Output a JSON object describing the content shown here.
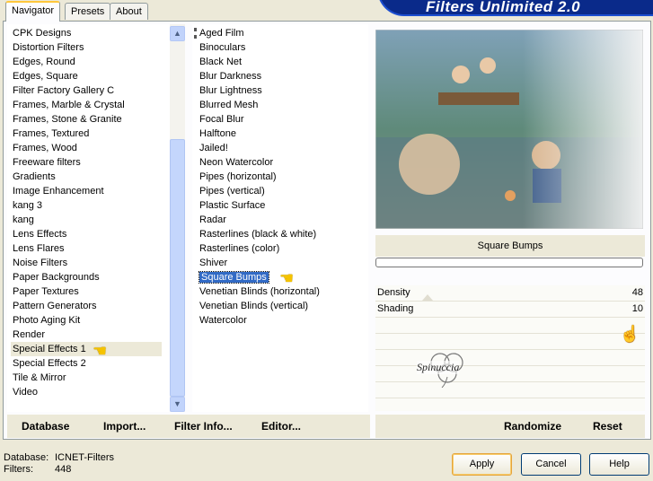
{
  "tabs": [
    {
      "label": "Navigator",
      "active": true
    },
    {
      "label": "Presets",
      "active": false
    },
    {
      "label": "About",
      "active": false
    }
  ],
  "banner_title": "Filters Unlimited 2.0",
  "categories": {
    "items": [
      "CPK Designs",
      "Distortion Filters",
      "Edges, Round",
      "Edges, Square",
      "Filter Factory Gallery C",
      "Frames, Marble & Crystal",
      "Frames, Stone & Granite",
      "Frames, Textured",
      "Frames, Wood",
      "Freeware filters",
      "Gradients",
      "Image Enhancement",
      "kang 3",
      "kang",
      "Lens Effects",
      "Lens Flares",
      "Noise Filters",
      "Paper Backgrounds",
      "Paper Textures",
      "Pattern Generators",
      "Photo Aging Kit",
      "Render",
      "Special Effects 1",
      "Special Effects 2",
      "Tile & Mirror",
      "Video"
    ],
    "selected": "Special Effects 1"
  },
  "filters": {
    "items": [
      "Aged Film",
      "Binoculars",
      "Black Net",
      "Blur Darkness",
      "Blur Lightness",
      "Blurred Mesh",
      "Focal Blur",
      "Halftone",
      "Jailed!",
      "Neon Watercolor",
      "Pipes (horizontal)",
      "Pipes (vertical)",
      "Plastic Surface",
      "Radar",
      "Rasterlines (black & white)",
      "Rasterlines (color)",
      "Shiver",
      "Square Bumps",
      "Venetian Blinds (horizontal)",
      "Venetian Blinds (vertical)",
      "Watercolor"
    ],
    "selected": "Square Bumps"
  },
  "preview": {
    "filter_name": "Square Bumps"
  },
  "params": [
    {
      "label": "Density",
      "value": "48"
    },
    {
      "label": "Shading",
      "value": "10"
    }
  ],
  "watermark": "Spinuccia",
  "left_buttons": {
    "database": "Database",
    "import": "Import...",
    "filter_info": "Filter Info...",
    "editor": "Editor..."
  },
  "right_buttons": {
    "randomize": "Randomize",
    "reset": "Reset"
  },
  "status": {
    "database_label": "Database:",
    "database_value": "ICNET-Filters",
    "filters_label": "Filters:",
    "filters_value": "448"
  },
  "dialog_buttons": {
    "apply": "Apply",
    "cancel": "Cancel",
    "help": "Help"
  },
  "colors": {
    "selection_blue": "#316ac5",
    "banner_blue": "#0a2a8a",
    "dialog_bg": "#ece9d8"
  },
  "icons": {
    "scroll_up": "chevron-up-icon",
    "scroll_down": "chevron-down-icon",
    "pointer": "pointing-hand-icon"
  }
}
